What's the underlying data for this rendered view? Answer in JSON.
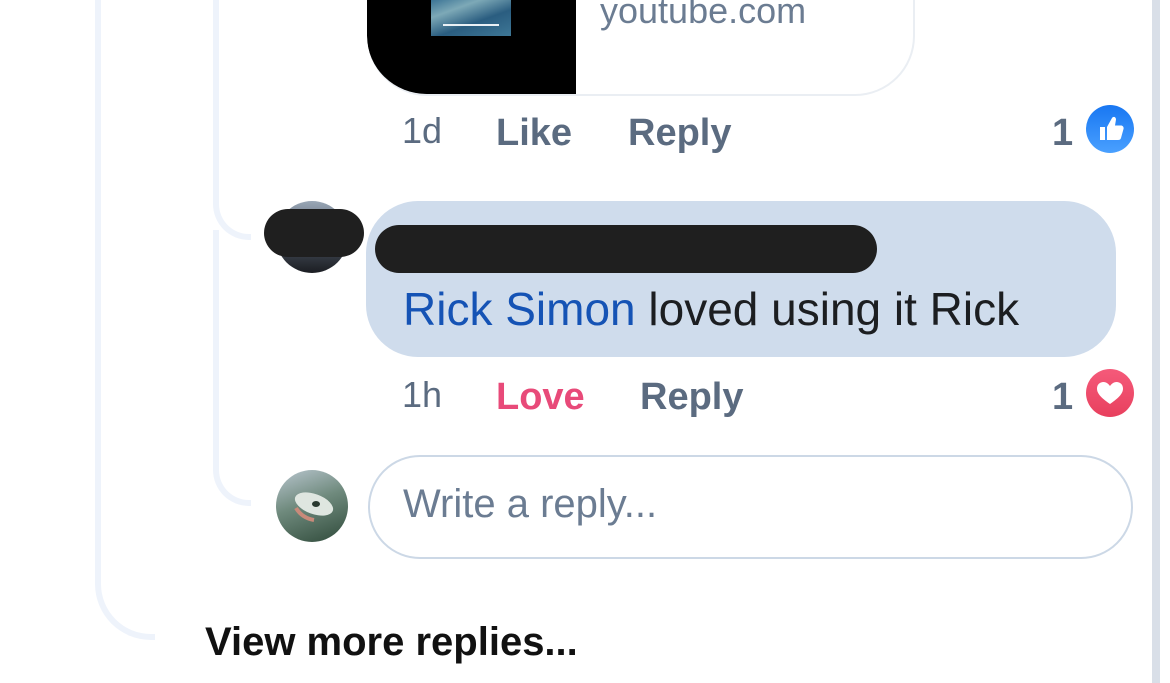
{
  "link_preview": {
    "domain": "youtube.com"
  },
  "first_comment_actions": {
    "time": "1d",
    "like_label": "Like",
    "reply_label": "Reply",
    "reaction_count": "1",
    "reaction_icon": "like-icon"
  },
  "reply_comment": {
    "mention": "Rick Simon",
    "text": " loved using it Rick",
    "time": "1h",
    "love_label": "Love",
    "reply_label": "Reply",
    "reaction_count": "1",
    "reaction_icon": "heart-icon"
  },
  "reply_box": {
    "placeholder": "Write a reply..."
  },
  "thread": {
    "view_more_label": "View more replies..."
  },
  "colors": {
    "bubble": "#cfdcec",
    "mention": "#1553b5",
    "love": "#e84a79",
    "like_blue": "#1877f2"
  }
}
